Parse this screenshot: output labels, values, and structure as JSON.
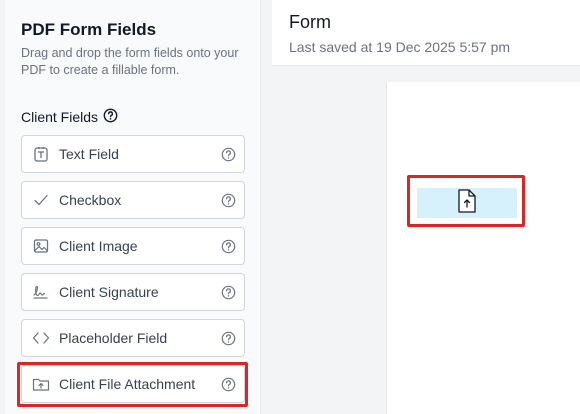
{
  "sidebar": {
    "title": "PDF Form Fields",
    "description": "Drag and drop the form fields onto your PDF to create a fillable form.",
    "section_label": "Client Fields",
    "items": [
      {
        "label": "Text Field",
        "icon": "text-field-icon"
      },
      {
        "label": "Checkbox",
        "icon": "checkmark-icon"
      },
      {
        "label": "Client Image",
        "icon": "image-icon"
      },
      {
        "label": "Client Signature",
        "icon": "signature-icon"
      },
      {
        "label": "Placeholder Field",
        "icon": "code-brackets-icon"
      },
      {
        "label": "Client File Attachment",
        "icon": "folder-upload-icon"
      }
    ]
  },
  "header": {
    "title": "Form",
    "saved": "Last saved at 19 Dec 2025 5:57 pm"
  },
  "canvas": {
    "placed_field_icon": "file-upload-icon"
  },
  "colors": {
    "highlight": "#dc2626",
    "field_fill": "#d6f1fb"
  }
}
